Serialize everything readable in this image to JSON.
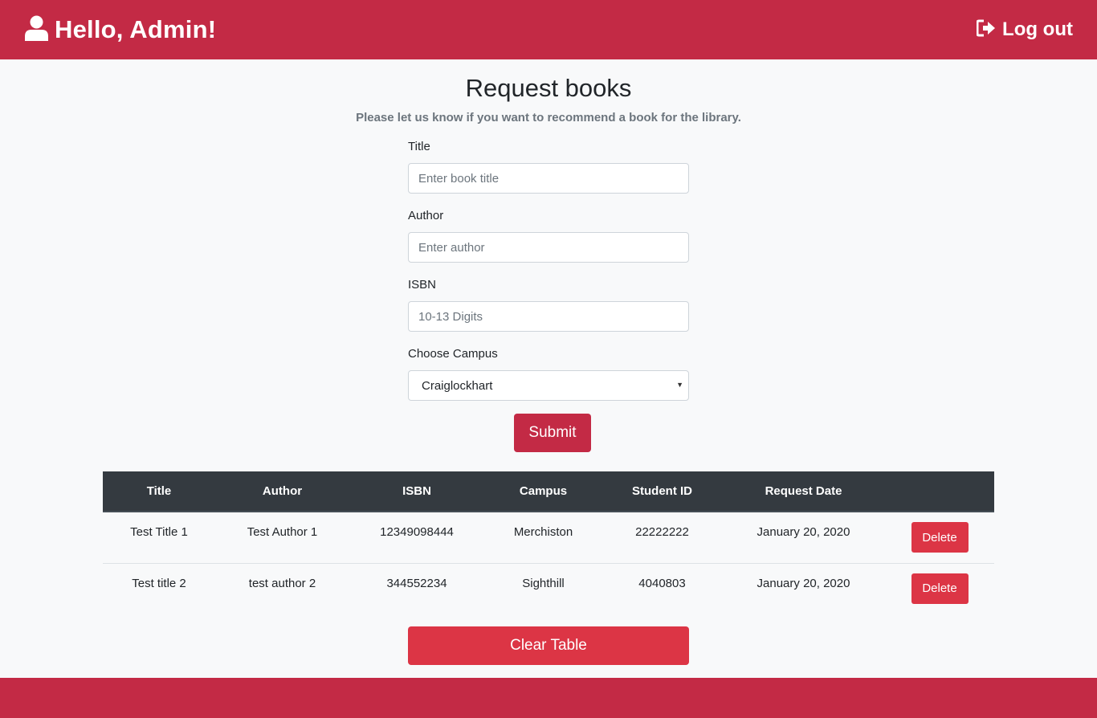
{
  "header": {
    "title": "Hello, Admin!",
    "user_icon": "user-icon",
    "logout_label": "Log out",
    "logout_icon": "sign-out-icon",
    "brand_color": "#c32a45"
  },
  "page": {
    "title": "Request books",
    "subtitle": "Please let us know if you want to recommend a book for the library."
  },
  "form": {
    "title_label": "Title",
    "title_placeholder": "Enter book title",
    "title_value": "",
    "author_label": "Author",
    "author_placeholder": "Enter author",
    "author_value": "",
    "isbn_label": "ISBN",
    "isbn_placeholder": "10-13 Digits",
    "isbn_value": "",
    "campus_label": "Choose Campus",
    "campus_selected": "Craiglockhart",
    "submit_label": "Submit"
  },
  "table": {
    "headers": [
      "Title",
      "Author",
      "ISBN",
      "Campus",
      "Student ID",
      "Request Date",
      ""
    ],
    "rows": [
      {
        "title": "Test Title 1",
        "author": "Test Author 1",
        "isbn": "12349098444",
        "campus": "Merchiston",
        "student_id": "22222222",
        "date": "January 20, 2020",
        "action": "Delete"
      },
      {
        "title": "Test title 2",
        "author": "test author 2",
        "isbn": "344552234",
        "campus": "Sighthill",
        "student_id": "4040803",
        "date": "January 20, 2020",
        "action": "Delete"
      }
    ]
  },
  "clear_label": "Clear Table"
}
